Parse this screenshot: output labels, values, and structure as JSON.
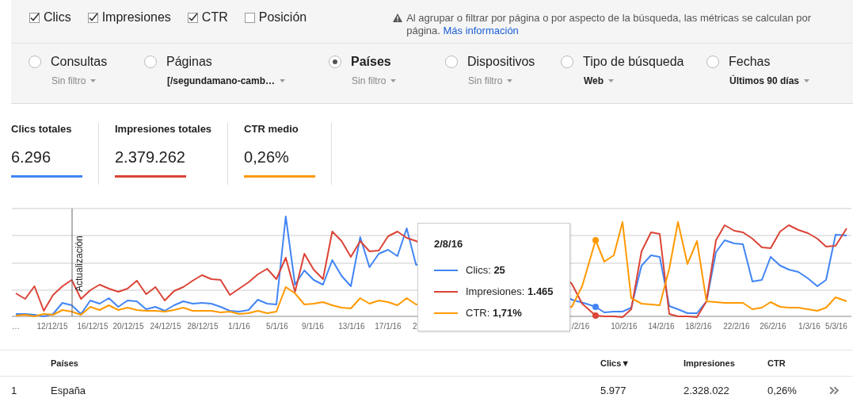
{
  "metric_toggles": [
    {
      "label": "Clics",
      "checked": true
    },
    {
      "label": "Impresiones",
      "checked": true
    },
    {
      "label": "CTR",
      "checked": true
    },
    {
      "label": "Posición",
      "checked": false
    }
  ],
  "notice": {
    "text": "Al agrupar o filtrar por página o por aspecto de la búsqueda, las métricas se calculan por página.",
    "link": "Más información"
  },
  "group_by": [
    {
      "label": "Consultas",
      "filter": "Sin filtro",
      "filter_set": false,
      "selected": false
    },
    {
      "label": "Páginas",
      "filter": "[/segundamano-camb…",
      "filter_set": true,
      "selected": false
    },
    {
      "label": "Países",
      "filter": "Sin filtro",
      "filter_set": false,
      "selected": true
    },
    {
      "label": "Dispositivos",
      "filter": "Sin filtro",
      "filter_set": false,
      "selected": false
    },
    {
      "label": "Tipo de búsqueda",
      "filter": "Web",
      "filter_set": true,
      "selected": false
    },
    {
      "label": "Fechas",
      "filter": "Últimos 90 días",
      "filter_set": true,
      "selected": false
    }
  ],
  "totals": [
    {
      "title": "Clics totales",
      "value": "6.296",
      "color": "#4285f4"
    },
    {
      "title": "Impresiones totales",
      "value": "2.379.262",
      "color": "#db4437"
    },
    {
      "title": "CTR medio",
      "value": "0,26%",
      "color": "#ff9900"
    }
  ],
  "chart": {
    "x_labels": [
      "…",
      "12/12/15",
      "16/12/15",
      "20/12/15",
      "24/12/15",
      "28/12/15",
      "1/1/16",
      "5/1/16",
      "9/1/16",
      "13/1/16",
      "17/1/16",
      "2",
      "/2/16",
      "10/2/16",
      "14/2/16",
      "18/2/16",
      "22/2/16",
      "26/2/16",
      "1/3/16",
      "5/3/16"
    ],
    "annotation": "Actualización",
    "tooltip": {
      "title": "2/8/16",
      "rows": [
        "Clics: **25**",
        "Impresiones: **1.465**",
        "CTR: **1,71%**"
      ]
    }
  },
  "table": {
    "columns": [
      "Países",
      "Clics▼",
      "Impresiones",
      "CTR"
    ],
    "rows": [
      {
        "rank": "1",
        "cells": [
          "España",
          "5.977",
          "2.328.022",
          "0,26%"
        ]
      }
    ]
  }
}
